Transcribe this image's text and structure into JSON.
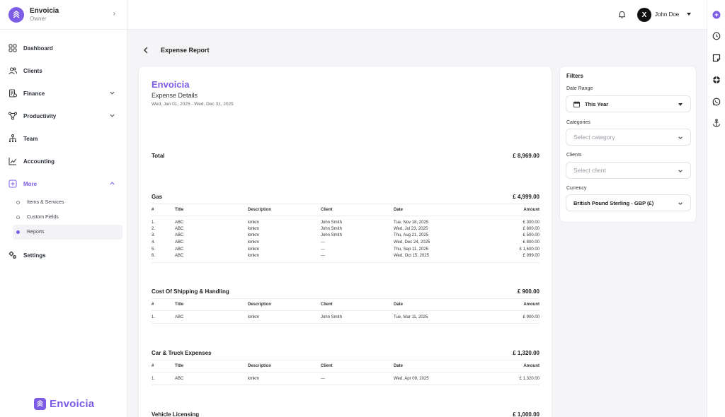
{
  "brand": {
    "name": "Envoicia",
    "role": "Owner",
    "footer_logo": "Envoicia",
    "accent": "#7c5ce6"
  },
  "sidebar": {
    "items": [
      {
        "label": "Dashboard",
        "icon": "grid-icon"
      },
      {
        "label": "Clients",
        "icon": "users-icon"
      },
      {
        "label": "Finance",
        "icon": "finance-icon"
      },
      {
        "label": "Productivity",
        "icon": "nodes-icon"
      },
      {
        "label": "Team",
        "icon": "org-icon"
      },
      {
        "label": "Accounting",
        "icon": "chart-icon"
      },
      {
        "label": "More",
        "icon": "plus-square-icon"
      },
      {
        "label": "Settings",
        "icon": "gears-icon"
      }
    ],
    "sub_items": [
      {
        "label": "Items & Services"
      },
      {
        "label": "Custom Fields"
      },
      {
        "label": "Reports"
      }
    ]
  },
  "topbar": {
    "user_name": "John Doe",
    "avatar_initial": "X"
  },
  "page": {
    "title": "Expense Report"
  },
  "report": {
    "brand": "Envoicia",
    "subtitle": "Expense Details",
    "date_range": "Wed, Jan 01, 2025 - Wed, Dec 31, 2025",
    "total_label": "Total",
    "total_value": "£ 8,969.00",
    "columns": {
      "num": "#",
      "title": "Title",
      "description": "Description",
      "client": "Client",
      "date": "Date",
      "amount": "Amount"
    },
    "sections": [
      {
        "name": "Gas",
        "total": "£ 4,999.00",
        "rows": [
          {
            "num": "1.",
            "title": "ABC",
            "description": "kmkm",
            "client": "John Smith",
            "date": "Tue, Nov 18, 2025",
            "amount": "£ 300.00"
          },
          {
            "num": "2.",
            "title": "ABC",
            "description": "kmkm",
            "client": "John Smith",
            "date": "Wed, Jul 23, 2025",
            "amount": "£ 800.00"
          },
          {
            "num": "3.",
            "title": "ABC",
            "description": "kmkm",
            "client": "John Smith",
            "date": "Thu, Aug 21, 2025",
            "amount": "£ 500.00"
          },
          {
            "num": "4.",
            "title": "ABC",
            "description": "kmkm",
            "client": "---",
            "date": "Wed, Dec 24, 2025",
            "amount": "£ 800.00"
          },
          {
            "num": "5.",
            "title": "ABC",
            "description": "kmkm",
            "client": "---",
            "date": "Thu, Sep 11, 2025",
            "amount": "£ 1,600.00"
          },
          {
            "num": "6.",
            "title": "ABC",
            "description": "kmkm",
            "client": "---",
            "date": "Wed, Oct 15, 2025",
            "amount": "£ 999.00"
          }
        ]
      },
      {
        "name": "Cost Of Shipping & Handling",
        "total": "£ 900.00",
        "rows": [
          {
            "num": "1.",
            "title": "ABC",
            "description": "kmkm",
            "client": "John Smith",
            "date": "Tue, Mar 11, 2025",
            "amount": "£ 900.00"
          }
        ]
      },
      {
        "name": "Car & Truck Expenses",
        "total": "£ 1,320.00",
        "rows": [
          {
            "num": "1.",
            "title": "ABC",
            "description": "kmkm",
            "client": "---",
            "date": "Wed, Apr 09, 2025",
            "amount": "£ 1,320.00"
          }
        ]
      },
      {
        "name": "Vehicle Licensing",
        "total": "£ 1,000.00",
        "rows": []
      }
    ]
  },
  "filters": {
    "title": "Filters",
    "date_range_label": "Date Range",
    "date_range_value": "This Year",
    "categories_label": "Categories",
    "categories_placeholder": "Select category",
    "clients_label": "Clients",
    "clients_placeholder": "Select client",
    "currency_label": "Currency",
    "currency_value": "British Pound Sterling - GBP (£)"
  }
}
